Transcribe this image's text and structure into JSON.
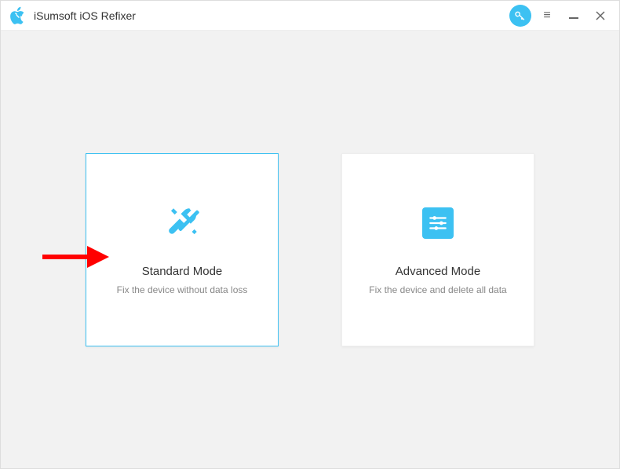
{
  "app": {
    "title": "iSumsoft iOS Refixer"
  },
  "modes": {
    "standard": {
      "title": "Standard Mode",
      "desc": "Fix the device without data loss"
    },
    "advanced": {
      "title": "Advanced Mode",
      "desc": "Fix the device and delete all data"
    }
  },
  "colors": {
    "accent": "#3cc1f2",
    "arrow": "#ff0000"
  }
}
